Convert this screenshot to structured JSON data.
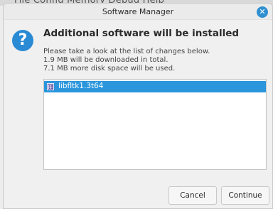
{
  "background_window": {
    "partial_menu_text": "File  Config  Memory  Debug  Help"
  },
  "dialog": {
    "title": "Software Manager",
    "close_icon": "close-icon",
    "question_icon": "question-icon",
    "headline": "Additional software will be installed",
    "lines": [
      "Please take a look at the list of changes below.",
      "1.9 MB will be downloaded in total.",
      "7.1 MB more disk space will be used."
    ],
    "packages": [
      {
        "name": "libfltk1.3t64",
        "selected": true,
        "icon": "package-icon"
      }
    ],
    "buttons": {
      "cancel": "Cancel",
      "continue": "Continue"
    }
  },
  "colors": {
    "accent": "#2b96dc",
    "question_icon": "#2a8ad4",
    "close_button": "#2f8fcf"
  }
}
